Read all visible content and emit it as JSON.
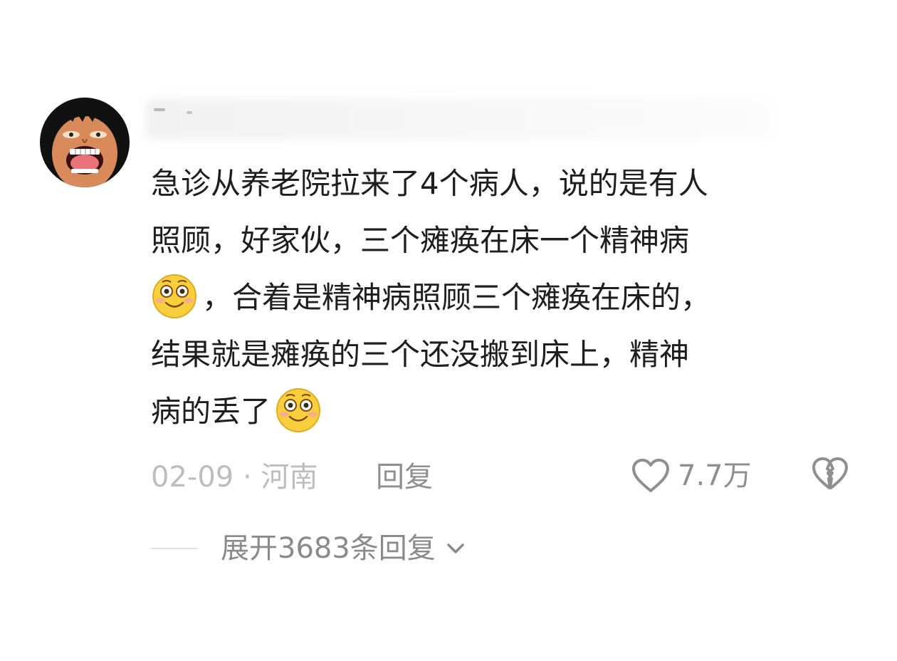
{
  "comment": {
    "lines": [
      "急诊从养老院拉来了4个病人，说的是有人",
      "照顾，好家伙，三个瘫痪在床一个精神病",
      "，合着是精神病照顾三个瘫痪在床的，",
      "结果就是瘫痪的三个还没搬到床上，精神",
      "病的丢了"
    ],
    "emoji_name": "smiling-face-emoji"
  },
  "meta": {
    "date": "02-09",
    "separator": " · ",
    "location": "河南"
  },
  "actions": {
    "reply_label": "回复",
    "like_count": "7.7万"
  },
  "replies": {
    "expand_label": "展开3683条回复"
  },
  "colors": {
    "text": "#1e1e1e",
    "meta": "#bdbdbd",
    "action": "#8f8f8f",
    "emoji_face": "#f7cf3c"
  },
  "icons": {
    "avatar": "avatar-cartoon-face",
    "like": "heart-outline-icon",
    "dislike": "broken-heart-icon",
    "expand": "chevron-down-icon"
  }
}
